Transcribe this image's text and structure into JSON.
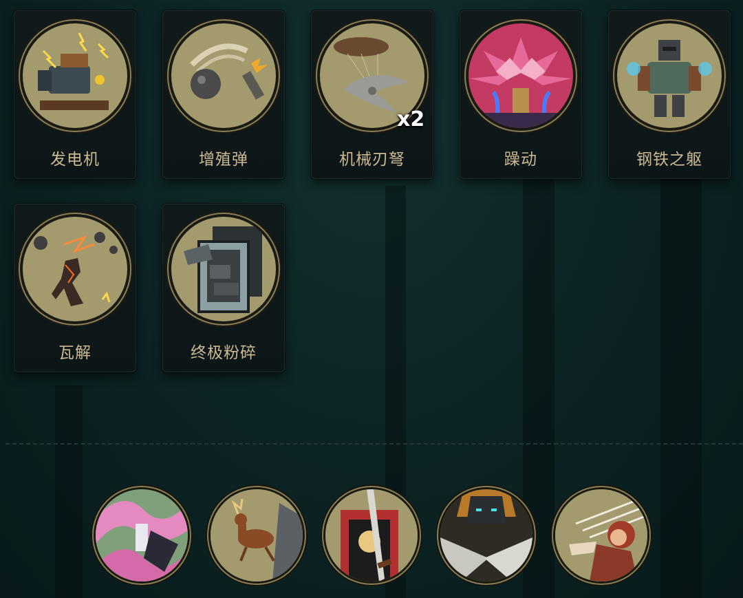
{
  "cards": [
    {
      "label": "发电机",
      "icon": "generator-icon"
    },
    {
      "label": "增殖弹",
      "icon": "proliferating-bomb-icon"
    },
    {
      "label": "机械刃弩",
      "icon": "mechanical-blade-crossbow-icon",
      "count": "x2"
    },
    {
      "label": "躁动",
      "icon": "restless-icon"
    },
    {
      "label": "钢铁之躯",
      "icon": "iron-body-icon"
    },
    {
      "label": "瓦解",
      "icon": "disintegrate-icon"
    },
    {
      "label": "终极粉碎",
      "icon": "ultimate-crush-icon"
    }
  ],
  "portraits": [
    {
      "icon": "ghost-swirl-portrait-icon"
    },
    {
      "icon": "deer-portrait-icon"
    },
    {
      "icon": "sword-banner-portrait-icon"
    },
    {
      "icon": "armored-warrior-portrait-icon"
    },
    {
      "icon": "hooded-archer-portrait-icon"
    }
  ],
  "colors": {
    "card_label": "#cbb992",
    "medallion_fill": "#a39a6e",
    "medallion_rim": "#8b7f58",
    "background": "#0c2223"
  }
}
